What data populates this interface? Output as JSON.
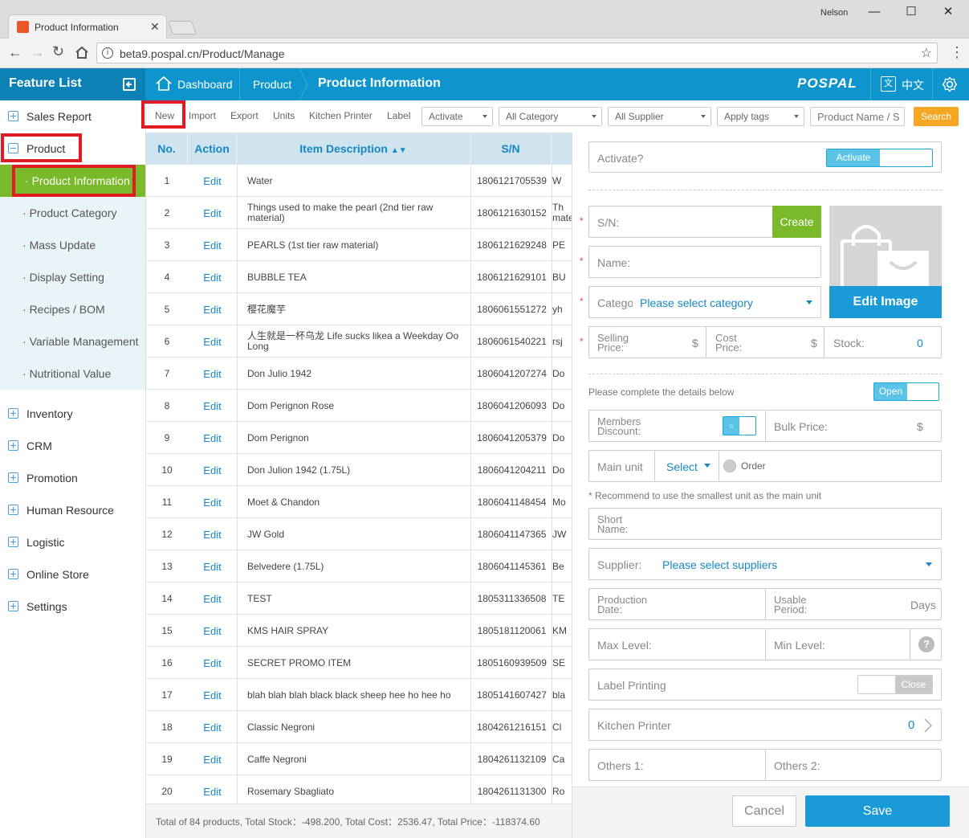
{
  "browser": {
    "tab_title": "Product Information",
    "user": "Nelson",
    "url": "beta9.pospal.cn/Product/Manage"
  },
  "header": {
    "feature_list": "Feature List",
    "breadcrumb": [
      "Dashboard",
      "Product",
      "Product Information"
    ],
    "logo": "POSPAL",
    "lang": "中文"
  },
  "sidebar": {
    "top": "Sales Report",
    "product": "Product",
    "sub": [
      "Product Information",
      "Product Category",
      "Mass Update",
      "Display Setting",
      "Recipes / BOM",
      "Variable Management",
      "Nutritional Value"
    ],
    "bottom": [
      "Inventory",
      "CRM",
      "Promotion",
      "Human Resource",
      "Logistic",
      "Online Store",
      "Settings"
    ]
  },
  "toolbar": {
    "new": "New",
    "import": "Import",
    "export": "Export",
    "units": "Units",
    "kitchen_printer": "Kitchen Printer",
    "label": "Label",
    "activate": "Activate",
    "category": "All Category",
    "supplier": "All Supplier",
    "tags": "Apply tags",
    "search_placeholder": "Product Name / S",
    "search": "Search"
  },
  "table": {
    "headers": {
      "no": "No.",
      "action": "Action",
      "desc": "Item Description",
      "sn": "S/N"
    },
    "edit_label": "Edit",
    "rows": [
      {
        "no": "1",
        "desc": "Water",
        "sn": "1806121705539",
        "extra": "W"
      },
      {
        "no": "2",
        "desc": "Things used to make the pearl (2nd tier raw material)",
        "sn": "1806121630152",
        "extra": "Th\nmate"
      },
      {
        "no": "3",
        "desc": "PEARLS (1st tier raw material)",
        "sn": "1806121629248",
        "extra": "PE"
      },
      {
        "no": "4",
        "desc": "BUBBLE TEA",
        "sn": "1806121629101",
        "extra": "BU"
      },
      {
        "no": "5",
        "desc": "樱花魔芋",
        "sn": "1806061551272",
        "extra": "yh"
      },
      {
        "no": "6",
        "desc": "人生就是一杯乌龙 Life sucks likea a Weekday Oo Long",
        "sn": "1806061540221",
        "extra": "rsj"
      },
      {
        "no": "7",
        "desc": "Don Julio 1942",
        "sn": "1806041207274",
        "extra": "Do"
      },
      {
        "no": "8",
        "desc": "Dom Perignon Rose",
        "sn": "1806041206093",
        "extra": "Do"
      },
      {
        "no": "9",
        "desc": "Dom Perignon",
        "sn": "1806041205379",
        "extra": "Do"
      },
      {
        "no": "10",
        "desc": "Don Julion 1942 (1.75L)",
        "sn": "1806041204211",
        "extra": "Do"
      },
      {
        "no": "11",
        "desc": "Moet & Chandon",
        "sn": "1806041148454",
        "extra": "Mo"
      },
      {
        "no": "12",
        "desc": "JW Gold",
        "sn": "1806041147365",
        "extra": "JW"
      },
      {
        "no": "13",
        "desc": "Belvedere (1.75L)",
        "sn": "1806041145361",
        "extra": "Be"
      },
      {
        "no": "14",
        "desc": "TEST",
        "sn": "1805311336508",
        "extra": "TE"
      },
      {
        "no": "15",
        "desc": "KMS HAIR SPRAY",
        "sn": "1805181120061",
        "extra": "KM"
      },
      {
        "no": "16",
        "desc": "SECRET PROMO ITEM",
        "sn": "1805160939509",
        "extra": "SE"
      },
      {
        "no": "17",
        "desc": "blah blah blah black black sheep hee ho hee ho",
        "sn": "1805141607427",
        "extra": "bla"
      },
      {
        "no": "18",
        "desc": "Classic Negroni",
        "sn": "1804261216151",
        "extra": "Cl"
      },
      {
        "no": "19",
        "desc": "Caffe Negroni",
        "sn": "1804261132109",
        "extra": "Ca"
      },
      {
        "no": "20",
        "desc": "Rosemary Sbagliato",
        "sn": "1804261131300",
        "extra": "Ro"
      }
    ],
    "footer": "Total of 84 products, Total Stock：-498.200, Total Cost：2536.47, Total Price：-118374.60"
  },
  "panel": {
    "activate_q": "Activate?",
    "activate_btn": "Activate",
    "sn_label": "S/N:",
    "create": "Create",
    "name_label": "Name:",
    "category_label": "Catego",
    "category_placeholder": "Please select category",
    "edit_image": "Edit Image",
    "selling_price": "Selling Price:",
    "cost_price": "Cost Price:",
    "currency": "$",
    "stock_label": "Stock:",
    "stock_value": "0",
    "details_text": "Please complete the details below",
    "open": "Open",
    "members_discount": "Members Discount:",
    "bulk_price": "Bulk Price:",
    "main_unit": "Main unit",
    "select": "Select",
    "order": "Order",
    "unit_note": "* Recommend to use the smallest unit as the main unit",
    "short_name": "Short Name:",
    "supplier_label": "Supplier:",
    "supplier_placeholder": "Please select suppliers",
    "production_date": "Production Date:",
    "usable_period": "Usable Period:",
    "days": "Days",
    "max_level": "Max Level:",
    "min_level": "Min Level:",
    "label_printing": "Label Printing",
    "close": "Close",
    "kitchen_printer": "Kitchen Printer",
    "kitchen_value": "0",
    "others1": "Others 1:",
    "others2": "Others 2:",
    "cancel": "Cancel",
    "save": "Save"
  },
  "colors": {
    "brand": "#0e95cd",
    "active_green": "#7ab929",
    "search_orange": "#f5a623",
    "highlight_red": "#e11a24"
  }
}
